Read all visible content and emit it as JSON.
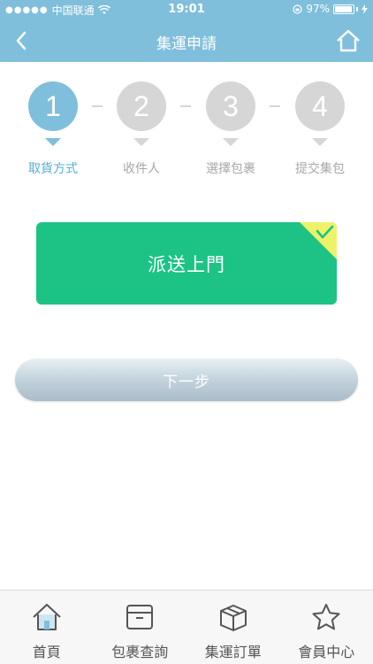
{
  "status_bar": {
    "carrier": "中国联通",
    "time": "19:01",
    "battery": "97%"
  },
  "nav": {
    "title": "集運申請",
    "back_icon": "chevron-left-icon",
    "home_icon": "home-icon"
  },
  "steps": [
    {
      "number": "1",
      "label": "取貨方式",
      "active": true
    },
    {
      "number": "2",
      "label": "收件人",
      "active": false
    },
    {
      "number": "3",
      "label": "選擇包裹",
      "active": false
    },
    {
      "number": "4",
      "label": "提交集包",
      "active": false
    }
  ],
  "option": {
    "label": "派送上門",
    "selected": true
  },
  "next_button": {
    "label": "下一步"
  },
  "tab_bar": {
    "items": [
      {
        "label": "首頁",
        "icon": "home-icon"
      },
      {
        "label": "包裹查詢",
        "icon": "box-icon"
      },
      {
        "label": "集運訂單",
        "icon": "package-icon"
      },
      {
        "label": "會員中心",
        "icon": "star-icon"
      }
    ]
  },
  "colors": {
    "brand": "#7fbfdc",
    "option_bg": "#1cc385",
    "check_corner": "#eef26a",
    "inactive": "#d6d6d6"
  }
}
